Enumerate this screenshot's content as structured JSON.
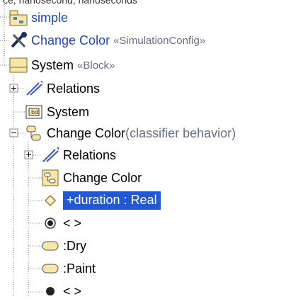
{
  "top_partial": "ce, nanosecond, nanoseconds",
  "tree": {
    "simple": {
      "label": "simple",
      "icon": "package-icon"
    },
    "change_color_config": {
      "label": "Change Color",
      "stereotype": "«SimulationConfig»",
      "icon": "tools-icon"
    },
    "system_block": {
      "label": "System",
      "stereotype": "«Block»",
      "icon": "block-icon"
    },
    "relations_1": {
      "label": "Relations",
      "icon": "relation-icon"
    },
    "system_diagram": {
      "label": "System",
      "icon": "diagram-icon"
    },
    "change_color_behavior": {
      "label": "Change Color",
      "suffix": "(classifier behavior)",
      "icon": "state-machine-icon"
    },
    "relations_2": {
      "label": "Relations",
      "icon": "relation-icon"
    },
    "change_color_diagram": {
      "label": "Change Color",
      "icon": "state-diagram-icon"
    },
    "duration": {
      "label": "+duration : Real",
      "icon": "property-icon",
      "selected": true
    },
    "initial": {
      "label": "< >",
      "icon": "initial-state-icon"
    },
    "dry": {
      "label": ":Dry",
      "icon": "state-icon"
    },
    "paint": {
      "label": ":Paint",
      "icon": "state-icon"
    },
    "final": {
      "label": "< >",
      "icon": "final-state-icon"
    }
  },
  "colors": {
    "link": "#1d43c9",
    "selection": "#2358d3",
    "stereotype": "#6b6b8a"
  }
}
